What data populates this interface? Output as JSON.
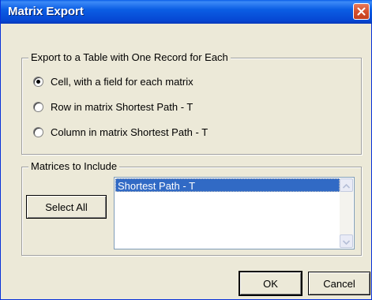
{
  "window": {
    "title": "Matrix Export"
  },
  "export_group": {
    "label": "Export to a Table with One Record for Each",
    "options": [
      {
        "label": "Cell, with a field for each matrix",
        "checked": true
      },
      {
        "label": "Row in matrix Shortest Path - T",
        "checked": false
      },
      {
        "label": "Column in matrix Shortest Path - T",
        "checked": false
      }
    ]
  },
  "matrices_group": {
    "label": "Matrices to Include",
    "select_all_label": "Select All",
    "items": [
      {
        "label": "Shortest Path - T",
        "selected": true
      }
    ]
  },
  "buttons": {
    "ok_label": "OK",
    "cancel_label": "Cancel"
  },
  "colors": {
    "title_bar": "#0a5ee8",
    "close_button": "#d5502e",
    "dialog_bg": "#ece9d8",
    "selection": "#316ac5"
  },
  "icons": {
    "close": "close-icon",
    "scroll_up": "chevron-up-icon",
    "scroll_down": "chevron-down-icon"
  }
}
